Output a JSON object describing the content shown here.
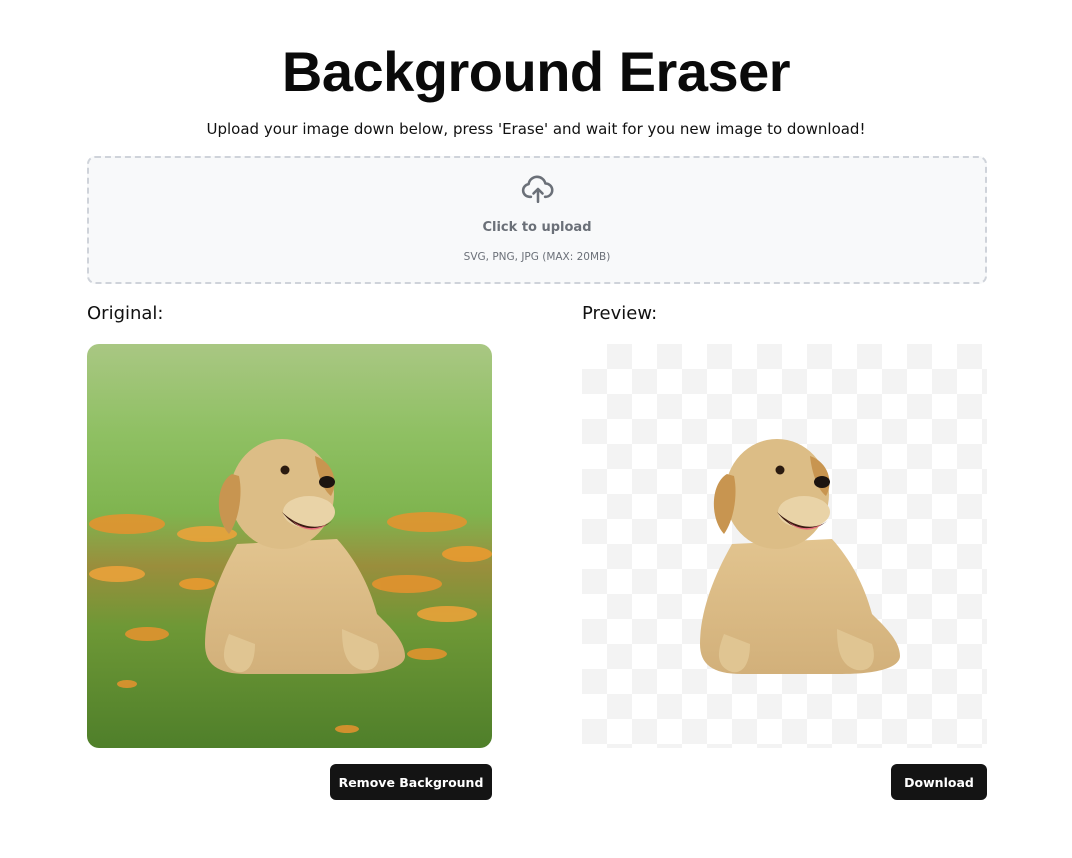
{
  "header": {
    "title": "Background Eraser",
    "subtitle": "Upload your image down below, press 'Erase' and wait for you new image to download!"
  },
  "upload": {
    "icon": "cloud-upload-icon",
    "label": "Click to upload",
    "hint": "SVG, PNG, JPG (MAX: 20MB)"
  },
  "original": {
    "heading": "Original:",
    "image": "golden-retriever-puppy-on-grass-with-orange-flowers",
    "button_label": "Remove Background"
  },
  "preview": {
    "heading": "Preview:",
    "image": "golden-retriever-puppy-cutout-on-transparent-background",
    "button_label": "Download"
  },
  "colors": {
    "button_bg": "#141414",
    "dropzone_bg": "#f8f9fa",
    "dropzone_border": "#cfd3da",
    "muted_text": "#6b7078"
  }
}
